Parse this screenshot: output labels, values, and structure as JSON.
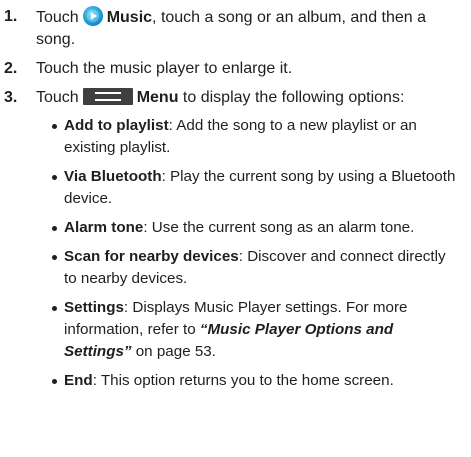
{
  "steps": [
    {
      "number": "1.",
      "pre": "Touch",
      "icon": "music-app-icon",
      "label": "Music",
      "post": ", touch a song or an album, and then a song."
    },
    {
      "number": "2.",
      "text": "Touch the music player to enlarge it."
    },
    {
      "number": "3.",
      "pre": "Touch",
      "icon": "menu-icon",
      "label": "Menu",
      "post": " to display the following options:"
    }
  ],
  "options": [
    {
      "term": "Add to playlist",
      "desc": ": Add the song to a new playlist or an existing playlist."
    },
    {
      "term": "Via Bluetooth",
      "desc": ": Play the current song by using a Bluetooth device."
    },
    {
      "term": "Alarm tone",
      "desc": ": Use the current song as an alarm tone."
    },
    {
      "term": "Scan for nearby devices",
      "desc": ": Discover and connect directly to nearby devices."
    },
    {
      "term": "Settings",
      "desc": ": Displays Music Player settings. For more information, refer to ",
      "xref": "“Music Player Options and Settings”",
      "desc_after": " on page 53."
    },
    {
      "term": "End",
      "desc": ": This option returns you to the home screen."
    }
  ]
}
